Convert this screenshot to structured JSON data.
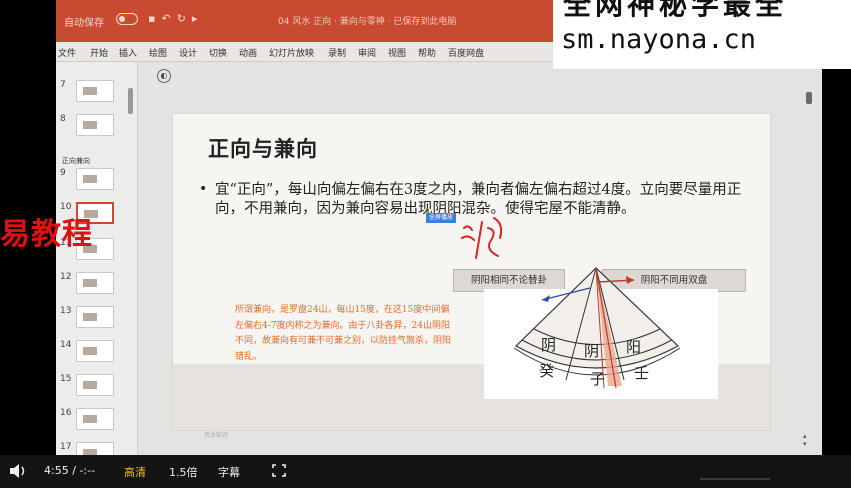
{
  "ppt": {
    "autosave_label": "自动保存",
    "doc_title": "04 风水 正向 · 兼向与零神 · 已保存到此电脑",
    "ribbon_tabs": [
      "文件",
      "开始",
      "插入",
      "绘图",
      "设计",
      "切换",
      "动画",
      "幻灯片放映",
      "录制",
      "审阅",
      "视图",
      "帮助",
      "百度网盘"
    ],
    "section_label": "正向兼向",
    "thumb_numbers": [
      "7",
      "8",
      "9",
      "10",
      "11",
      "12",
      "13",
      "14",
      "15",
      "16",
      "17"
    ]
  },
  "watermark": {
    "top_text": "全网神秘学最全",
    "url": "sm.nayona.cn"
  },
  "overlay": {
    "brand": "易教程"
  },
  "slide": {
    "title": "正向与兼向",
    "bullet_text": "宜“正向”，每山向偏左偏右在3度之内，兼向者偏左偏右超过4度。立向要尽量用正向，不用兼向，因为兼向容易出现阴阳混杂。使得宅屋不能清静。",
    "selection_tag": "全屏播放",
    "box_left": "阴阳相同不论替卦",
    "box_right": "阴阳不同用双盘",
    "note": "所谓兼向，是罗盘24山，每山15度，在这15度中间偏左偏右4-7度内称之为兼向。由于八卦各异，24山阴阳不同，故兼向有可兼不可兼之别，以防挂气煞杀，阴阳错乱。",
    "diagram_labels": [
      "阴",
      "阴",
      "阳",
      "癸",
      "子",
      "壬"
    ],
    "footer": "风水知识"
  },
  "player": {
    "time_current": "4:55",
    "time_sep": "/",
    "time_total": "-:--",
    "quality": "高清",
    "speed": "1.5倍",
    "subtitle": "字幕"
  },
  "colors": {
    "ppt_accent": "#c84a30",
    "overlay_red": "#dd1111",
    "note_orange": "#e06d2e",
    "quality_gold": "#f0c000"
  }
}
